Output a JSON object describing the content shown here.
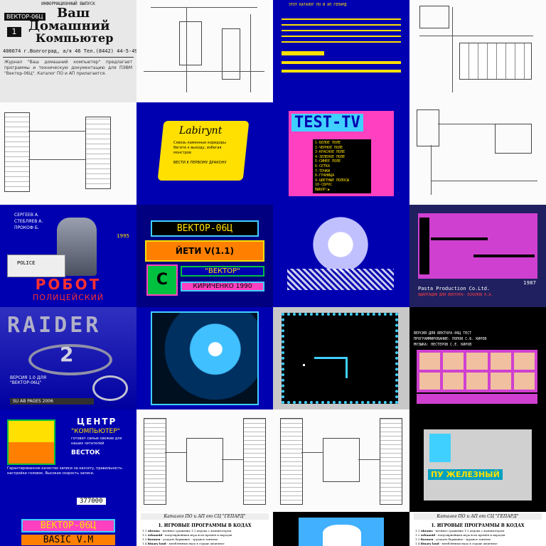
{
  "row1": {
    "cover": {
      "banner": "ИНФОРМАЦИОННЫЙ ВЫПУСК",
      "line1": "Ваш",
      "line2": "Домашний",
      "line3": "Компьютер",
      "badge": "ВЕКТОР-06Ц",
      "num": "1",
      "address": "400074 г.Волгоград, а/я 46 Тел.(8442) 44-5-49",
      "text": "Журнал \"Ваш домашний компьютер\" предлагает программы и техническую документацию для ПЭВМ \"Вектор-06Ц\". Каталог ПО и АП прилагается."
    },
    "blue_menu_header": "ЭТОТ КАТАЛОГ ПО И АП ГЕПАРД"
  },
  "row2": {
    "labyrinth": {
      "title": "Labirynt",
      "text": "Сквозь каменные коридоры бегите к выходу, избегая монстров",
      "sub": "ВЕСТИ К ПЕРВОМУ ДРАКОНУ"
    },
    "testtv": {
      "title": "TEST-TV",
      "items": [
        "1-БЕЛОЕ ПОЛЕ",
        "2-ЧЕРНОЕ ПОЛЕ",
        "3-КРАСНОЕ ПОЛЕ",
        "4-ЗЕЛЕНОЕ ПОЛЕ",
        "5-СИНЕЕ ПОЛЕ",
        "6-СЕТКА",
        "7-ТОЧКИ",
        "8-ГРАНИЦА",
        "9-ЦВЕТНЫЕ ПОЛОСЫ",
        "10-СБРОС",
        "ВЫБОР:▶"
      ]
    }
  },
  "row3": {
    "robocop": {
      "authors": "СЕРГЕЕВ А. СТЕБЛЯЕВ А. ПРОКОФ Б.",
      "year": "1995",
      "plate": "POLICE",
      "title": "РОБОТ",
      "subtitle": "ПОЛИЦЕЙСКИЙ"
    },
    "yeti": {
      "header": "ВЕКТОР-06Ц",
      "title": "ЙЕТИ V(1.1)",
      "brand": "\"ВЕКТОР\"",
      "author": "КИРИЧЕНКО 1990",
      "logo": "C"
    },
    "platform": {
      "year": "1987",
      "credit": "Pasta Production Co.Ltd.",
      "credit2": "АДАПТАЦИЯ ДЛЯ ВЕКТОРА: ОСКОЛОВ К.А."
    }
  },
  "row4": {
    "raider": {
      "title": "RAIDER",
      "num": "2",
      "info": "ВЕРСИЯ 1.0 ДЛЯ \"ВЕКТОР-06Ц\"",
      "footer": "SU AB PAGES 2006"
    },
    "portraits": {
      "line1": "ВЕРСИЯ ДЛЯ ВЕКТОРА-06Ц ТЕСТ",
      "line2": "ПРОГРАММИРОВАНИЕ: ПОПОВ С.Б. КИРОВ",
      "line3": "МУЗЫКА: НЕСТЕРОВ С.Е. КИРОВ"
    }
  },
  "row5": {
    "center": {
      "title": "ЦЕНТР",
      "subtitle": "\"КОМПЬЮТЕР\"",
      "text": "готовит самые свежие для наших читателей",
      "brand": "ВЕСТОК",
      "body": "Гарантированное качество записи на кассету, правильность настройки головок. Высокая скорость записи.",
      "phone": "377000"
    },
    "pc_title": "ПУ ЖЕЛЕЗНЫЙ"
  },
  "row6": {
    "basic": {
      "header": "ВЕКТОР-06Ц",
      "title": "BASIC V.M"
    },
    "catalog": {
      "header": "Каталог ПО и АП от СЦ \"ГЕПАРД\"",
      "section": "1. ИГРОВЫЕ ПРОГРАММЫ В КОДАХ",
      "items": [
        {
          "n": "1.1",
          "name": "Abrams",
          "desc": " - военное сражение 1-2 игрока с компьютером"
        },
        {
          "n": "1.2",
          "name": "Arkanoid",
          "desc": " - популярнейшая игра всех времён и народов"
        },
        {
          "n": "1.3",
          "name": "Barmen",
          "desc": " - угадать барышню - трудное занятие"
        },
        {
          "n": "1.4",
          "name": "Binary land",
          "desc": " - влюблённых надо в сердце двоичное"
        },
        {
          "n": "1.5",
          "name": "Без рыбалки",
          "desc": " - без пруда не вытащишь и рыбки из пруда"
        }
      ]
    }
  },
  "colors": {
    "vector_blue": "#0000b0",
    "vector_yellow": "#ffe000",
    "magenta": "#ff40c0",
    "cyan": "#40d0ff"
  }
}
